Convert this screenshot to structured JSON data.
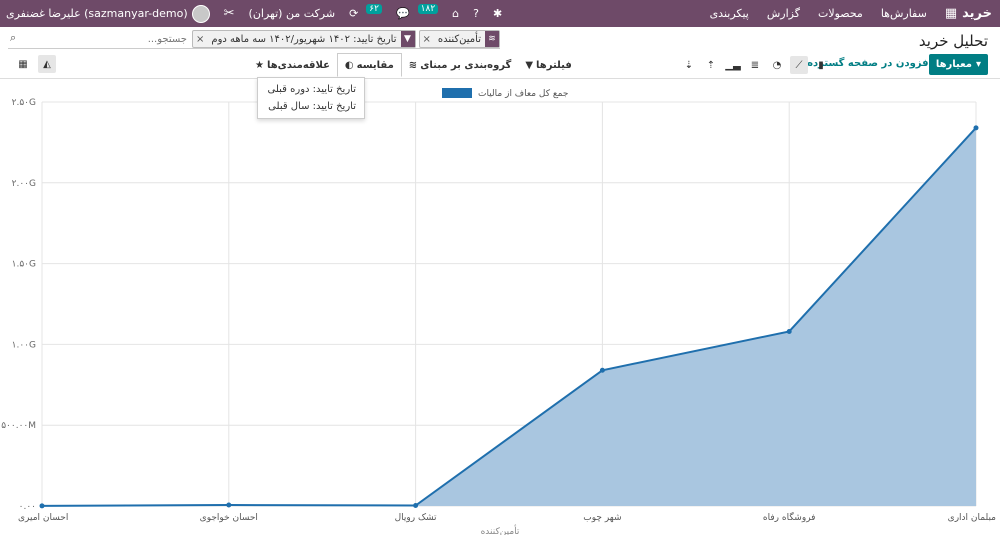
{
  "topbar": {
    "app_name": "خرید",
    "menu": [
      "سفارش‌ها",
      "محصولات",
      "گزارش",
      "پیکربندی"
    ],
    "company": "شرکت من (تهران)",
    "activity_count": "۶۲",
    "message_count": "۱۸۲",
    "user_name": "علیرضا غضنفری (sazmanyar-demo)"
  },
  "page": {
    "title": "تحلیل خرید"
  },
  "search": {
    "facets": [
      {
        "icon": "layers-icon",
        "text": "تأمین‌کننده"
      },
      {
        "icon": "filter-icon",
        "text": "تاریخ تایید: ۱۴۰۲ شهریور/۱۴۰۲ سه ماهه دوم"
      }
    ],
    "placeholder": "جستجو..."
  },
  "toolbar": {
    "measures_label": "معیارها",
    "insert_label": "افزودن در صفحه گسترده",
    "filters_label": "فیلترها",
    "groupby_label": "گروه‌بندی بر مبنای",
    "compare_label": "مقایسه",
    "favorites_label": "علاقه‌مندی‌ها"
  },
  "compare_menu": {
    "items": [
      "تاریخ تایید: دوره قبلی",
      "تاریخ تایید: سال قبلی"
    ]
  },
  "chart_data": {
    "type": "area",
    "categories": [
      "احسان امیری",
      "احسان خواجوی",
      "تشک رویال",
      "شهر چوب",
      "فروشگاه رفاه",
      "مبلمان اداری"
    ],
    "series": [
      {
        "name": "جمع کل معاف از مالیات",
        "values": [
          1000000,
          6000000,
          3000000,
          840000000,
          1080000000,
          2340000000
        ]
      }
    ],
    "ylim": [
      0,
      2500000000
    ],
    "yticks": [
      "۰.۰۰",
      "۵۰۰.۰۰M",
      "۱.۰۰G",
      "۱.۵۰G",
      "۲.۰۰G",
      "۲.۵۰G"
    ],
    "ytick_values": [
      0,
      500000000,
      1000000000,
      1500000000,
      2000000000,
      2500000000
    ],
    "xlabel": "تأمین‌کننده",
    "ylabel": "",
    "legend": "top-center",
    "colors": {
      "line": "#1f6fad",
      "fill": "#a9c6e0"
    }
  }
}
